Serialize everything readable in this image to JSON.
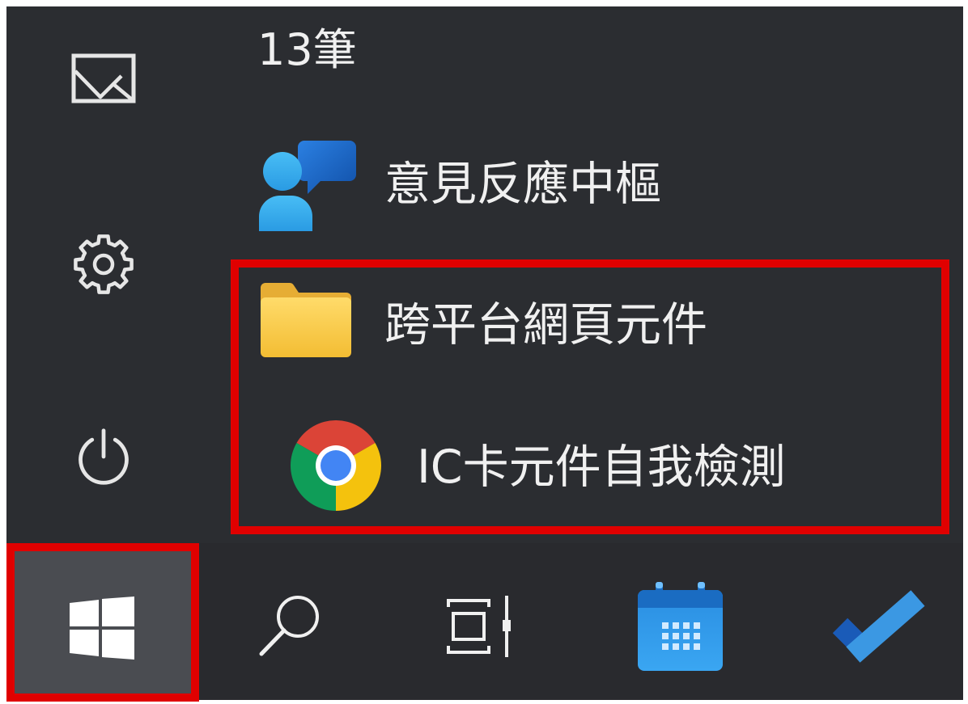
{
  "rail": {
    "items": [
      {
        "icon": "pictures-icon"
      },
      {
        "icon": "settings-icon"
      },
      {
        "icon": "power-icon"
      }
    ]
  },
  "app_list": {
    "group_header": "13筆",
    "items": [
      {
        "label": "意見反應中樞",
        "icon": "feedback-hub-icon"
      },
      {
        "label": "跨平台網頁元件",
        "icon": "folder-icon"
      },
      {
        "label": "IC卡元件自我檢測",
        "icon": "chrome-icon"
      }
    ]
  },
  "taskbar": {
    "items": [
      {
        "icon": "windows-logo-icon"
      },
      {
        "icon": "search-icon"
      },
      {
        "icon": "task-view-icon"
      },
      {
        "icon": "calendar-icon"
      },
      {
        "icon": "todo-check-icon"
      }
    ]
  },
  "colors": {
    "menu_background": "#2b2d31",
    "taskbar_background": "#292a2e",
    "start_button_background": "#4a4c51",
    "highlight_border": "#e00000",
    "text": "#f0f0f0"
  }
}
